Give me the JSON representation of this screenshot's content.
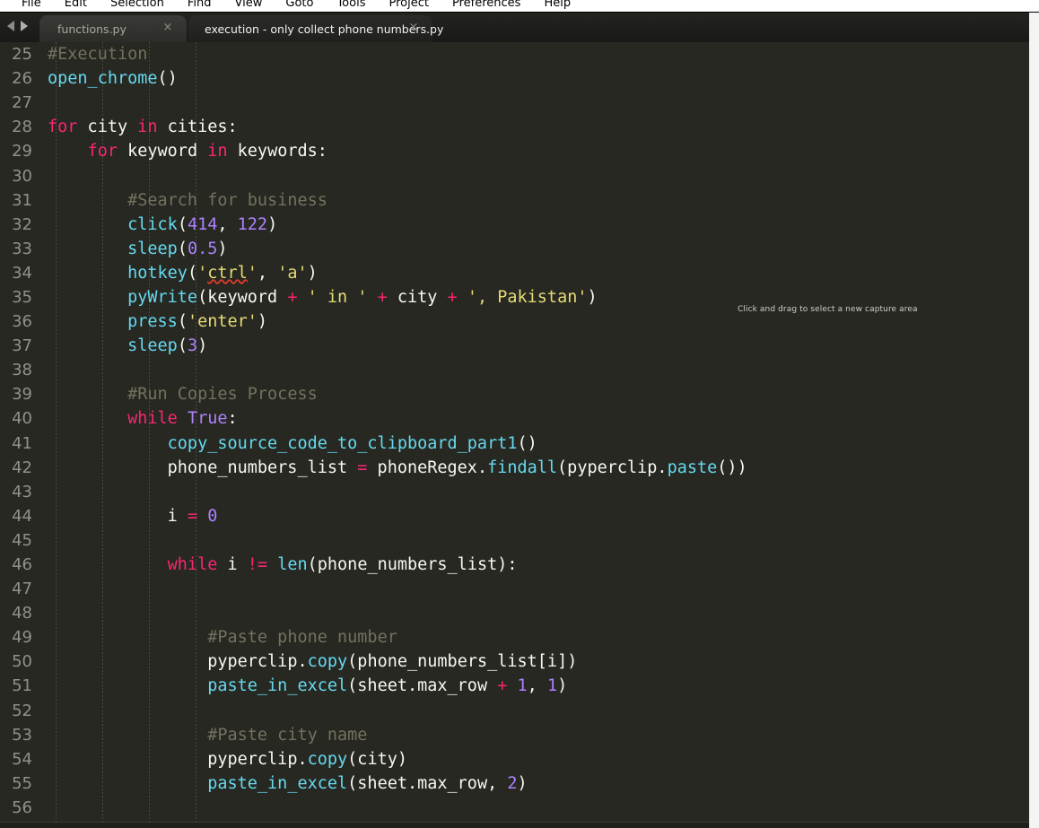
{
  "menu": {
    "items": [
      "File",
      "Edit",
      "Selection",
      "Find",
      "View",
      "Goto",
      "Tools",
      "Project",
      "Preferences",
      "Help"
    ]
  },
  "tabbar": {
    "nav_prev_icon": "triangle-left-icon",
    "nav_next_icon": "triangle-right-icon",
    "close_glyph": "×",
    "tabs": [
      {
        "label": "functions.py",
        "active": false
      },
      {
        "label": "execution - only collect phone numbers.py",
        "active": true
      }
    ]
  },
  "overlay": {
    "capture_hint": "Click and drag to select a new capture area"
  },
  "editor": {
    "first_line_number": 25,
    "theme": {
      "background": "#272822",
      "foreground": "#f8f8f2",
      "comment": "#75715e",
      "keyword": "#f92672",
      "function": "#66d9ef",
      "number": "#ae81ff",
      "string": "#e6db74",
      "line_number": "#90918a",
      "gutter_guide": "#55564d",
      "spellcheck_underline": "#e03b2f"
    },
    "lines": [
      {
        "n": 25,
        "tokens": [
          {
            "t": "#Execution",
            "c": "com"
          }
        ]
      },
      {
        "n": 26,
        "tokens": [
          {
            "t": "open_chrome",
            "c": "fn"
          },
          {
            "t": "()",
            "c": "pln"
          }
        ]
      },
      {
        "n": 27,
        "tokens": []
      },
      {
        "n": 28,
        "tokens": [
          {
            "t": "for",
            "c": "kw"
          },
          {
            "t": " city ",
            "c": "pln"
          },
          {
            "t": "in",
            "c": "kw"
          },
          {
            "t": " cities:",
            "c": "pln"
          }
        ]
      },
      {
        "n": 29,
        "tokens": [
          {
            "t": "    ",
            "c": "pln"
          },
          {
            "t": "for",
            "c": "kw"
          },
          {
            "t": " keyword ",
            "c": "pln"
          },
          {
            "t": "in",
            "c": "kw"
          },
          {
            "t": " keywords:",
            "c": "pln"
          }
        ]
      },
      {
        "n": 30,
        "tokens": []
      },
      {
        "n": 31,
        "tokens": [
          {
            "t": "        ",
            "c": "pln"
          },
          {
            "t": "#Search for business",
            "c": "com"
          }
        ]
      },
      {
        "n": 32,
        "tokens": [
          {
            "t": "        ",
            "c": "pln"
          },
          {
            "t": "click",
            "c": "fn"
          },
          {
            "t": "(",
            "c": "pln"
          },
          {
            "t": "414",
            "c": "num"
          },
          {
            "t": ", ",
            "c": "pln"
          },
          {
            "t": "122",
            "c": "num"
          },
          {
            "t": ")",
            "c": "pln"
          }
        ]
      },
      {
        "n": 33,
        "tokens": [
          {
            "t": "        ",
            "c": "pln"
          },
          {
            "t": "sleep",
            "c": "fn"
          },
          {
            "t": "(",
            "c": "pln"
          },
          {
            "t": "0.5",
            "c": "num"
          },
          {
            "t": ")",
            "c": "pln"
          }
        ]
      },
      {
        "n": 34,
        "tokens": [
          {
            "t": "        ",
            "c": "pln"
          },
          {
            "t": "hotkey",
            "c": "fn"
          },
          {
            "t": "(",
            "c": "pln"
          },
          {
            "t": "'",
            "c": "str"
          },
          {
            "t": "ctrl",
            "c": "str",
            "spell": true
          },
          {
            "t": "'",
            "c": "str"
          },
          {
            "t": ", ",
            "c": "pln"
          },
          {
            "t": "'a'",
            "c": "str"
          },
          {
            "t": ")",
            "c": "pln"
          }
        ]
      },
      {
        "n": 35,
        "tokens": [
          {
            "t": "        ",
            "c": "pln"
          },
          {
            "t": "pyWrite",
            "c": "fn"
          },
          {
            "t": "(keyword ",
            "c": "pln"
          },
          {
            "t": "+",
            "c": "kw"
          },
          {
            "t": " ",
            "c": "pln"
          },
          {
            "t": "' in '",
            "c": "str"
          },
          {
            "t": " ",
            "c": "pln"
          },
          {
            "t": "+",
            "c": "kw"
          },
          {
            "t": " city ",
            "c": "pln"
          },
          {
            "t": "+",
            "c": "kw"
          },
          {
            "t": " ",
            "c": "pln"
          },
          {
            "t": "', Pakistan'",
            "c": "str"
          },
          {
            "t": ")",
            "c": "pln"
          }
        ]
      },
      {
        "n": 36,
        "tokens": [
          {
            "t": "        ",
            "c": "pln"
          },
          {
            "t": "press",
            "c": "fn"
          },
          {
            "t": "(",
            "c": "pln"
          },
          {
            "t": "'enter'",
            "c": "str"
          },
          {
            "t": ")",
            "c": "pln"
          }
        ]
      },
      {
        "n": 37,
        "tokens": [
          {
            "t": "        ",
            "c": "pln"
          },
          {
            "t": "sleep",
            "c": "fn"
          },
          {
            "t": "(",
            "c": "pln"
          },
          {
            "t": "3",
            "c": "num"
          },
          {
            "t": ")",
            "c": "pln"
          }
        ]
      },
      {
        "n": 38,
        "tokens": []
      },
      {
        "n": 39,
        "tokens": [
          {
            "t": "        ",
            "c": "pln"
          },
          {
            "t": "#Run Copies Process",
            "c": "com"
          }
        ]
      },
      {
        "n": 40,
        "tokens": [
          {
            "t": "        ",
            "c": "pln"
          },
          {
            "t": "while",
            "c": "kw"
          },
          {
            "t": " ",
            "c": "pln"
          },
          {
            "t": "True",
            "c": "num"
          },
          {
            "t": ":",
            "c": "pln"
          }
        ]
      },
      {
        "n": 41,
        "tokens": [
          {
            "t": "            ",
            "c": "pln"
          },
          {
            "t": "copy_source_code_to_clipboard_part1",
            "c": "fn"
          },
          {
            "t": "()",
            "c": "pln"
          }
        ]
      },
      {
        "n": 42,
        "tokens": [
          {
            "t": "            ",
            "c": "pln"
          },
          {
            "t": "phone_numbers_list ",
            "c": "pln"
          },
          {
            "t": "=",
            "c": "kw"
          },
          {
            "t": " phoneRegex.",
            "c": "pln"
          },
          {
            "t": "findall",
            "c": "fn"
          },
          {
            "t": "(pyperclip.",
            "c": "pln"
          },
          {
            "t": "paste",
            "c": "fn"
          },
          {
            "t": "())",
            "c": "pln"
          }
        ]
      },
      {
        "n": 43,
        "tokens": []
      },
      {
        "n": 44,
        "tokens": [
          {
            "t": "            ",
            "c": "pln"
          },
          {
            "t": "i ",
            "c": "pln"
          },
          {
            "t": "=",
            "c": "kw"
          },
          {
            "t": " ",
            "c": "pln"
          },
          {
            "t": "0",
            "c": "num"
          }
        ]
      },
      {
        "n": 45,
        "tokens": []
      },
      {
        "n": 46,
        "tokens": [
          {
            "t": "            ",
            "c": "pln"
          },
          {
            "t": "while",
            "c": "kw"
          },
          {
            "t": " i ",
            "c": "pln"
          },
          {
            "t": "!=",
            "c": "kw"
          },
          {
            "t": " ",
            "c": "pln"
          },
          {
            "t": "len",
            "c": "fn"
          },
          {
            "t": "(phone_numbers_list):",
            "c": "pln"
          }
        ]
      },
      {
        "n": 47,
        "tokens": []
      },
      {
        "n": 48,
        "tokens": []
      },
      {
        "n": 49,
        "tokens": [
          {
            "t": "                ",
            "c": "pln"
          },
          {
            "t": "#Paste phone number",
            "c": "com"
          }
        ]
      },
      {
        "n": 50,
        "tokens": [
          {
            "t": "                ",
            "c": "pln"
          },
          {
            "t": "pyperclip.",
            "c": "pln"
          },
          {
            "t": "copy",
            "c": "fn"
          },
          {
            "t": "(phone_numbers_list[i])",
            "c": "pln"
          }
        ]
      },
      {
        "n": 51,
        "tokens": [
          {
            "t": "                ",
            "c": "pln"
          },
          {
            "t": "paste_in_excel",
            "c": "fn"
          },
          {
            "t": "(sheet.max_row ",
            "c": "pln"
          },
          {
            "t": "+",
            "c": "kw"
          },
          {
            "t": " ",
            "c": "pln"
          },
          {
            "t": "1",
            "c": "num"
          },
          {
            "t": ", ",
            "c": "pln"
          },
          {
            "t": "1",
            "c": "num"
          },
          {
            "t": ")",
            "c": "pln"
          }
        ]
      },
      {
        "n": 52,
        "tokens": []
      },
      {
        "n": 53,
        "tokens": [
          {
            "t": "                ",
            "c": "pln"
          },
          {
            "t": "#Paste city name",
            "c": "com"
          }
        ]
      },
      {
        "n": 54,
        "tokens": [
          {
            "t": "                ",
            "c": "pln"
          },
          {
            "t": "pyperclip.",
            "c": "pln"
          },
          {
            "t": "copy",
            "c": "fn"
          },
          {
            "t": "(city)",
            "c": "pln"
          }
        ]
      },
      {
        "n": 55,
        "tokens": [
          {
            "t": "                ",
            "c": "pln"
          },
          {
            "t": "paste_in_excel",
            "c": "fn"
          },
          {
            "t": "(sheet.max_row, ",
            "c": "pln"
          },
          {
            "t": "2",
            "c": "num"
          },
          {
            "t": ")",
            "c": "pln"
          }
        ]
      },
      {
        "n": 56,
        "tokens": []
      }
    ],
    "indent_guide_x": [
      62,
      114,
      166,
      218
    ]
  }
}
